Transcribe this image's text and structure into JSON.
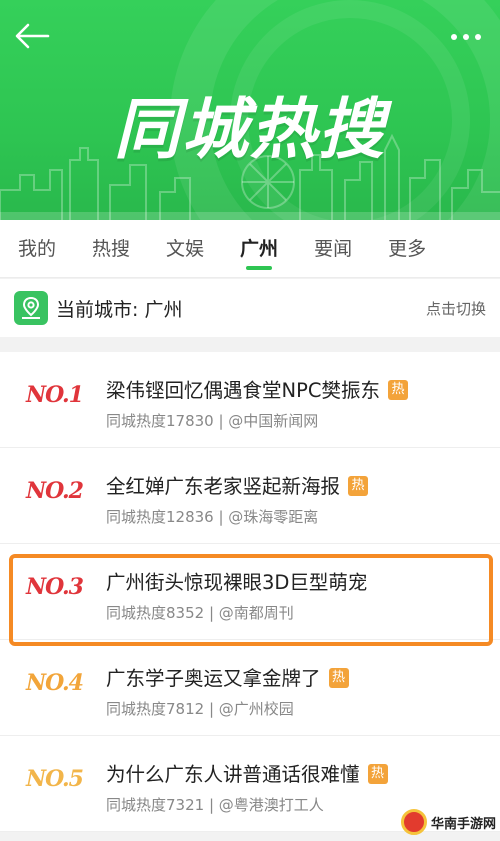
{
  "header": {
    "title": "同城热搜",
    "back_icon": "back-arrow-icon",
    "more_icon": "more-dots-icon",
    "colors": {
      "brand": "#2ec552"
    }
  },
  "tabs": [
    {
      "label": "我的",
      "active": false
    },
    {
      "label": "热搜",
      "active": false
    },
    {
      "label": "文娱",
      "active": false
    },
    {
      "label": "广州",
      "active": true
    },
    {
      "label": "要闻",
      "active": false
    },
    {
      "label": "更多",
      "active": false
    }
  ],
  "city": {
    "label": "当前城市: 广州",
    "switch_label": "点击切换",
    "icon": "location-pin-icon"
  },
  "list": [
    {
      "rank": "NO.1",
      "title": "梁伟铿回忆偶遇食堂NPC樊振东",
      "hot": "热",
      "meta": "同城热度17830 | @中国新闻网"
    },
    {
      "rank": "NO.2",
      "title": "全红婵广东老家竖起新海报",
      "hot": "热",
      "meta": "同城热度12836 | @珠海零距离"
    },
    {
      "rank": "NO.3",
      "title": "广州街头惊现裸眼3D巨型萌宠",
      "hot": "",
      "meta": "同城热度8352 | @南都周刊"
    },
    {
      "rank": "NO.4",
      "title": "广东学子奥运又拿金牌了",
      "hot": "热",
      "meta": "同城热度7812 | @广州校园"
    },
    {
      "rank": "NO.5",
      "title": "为什么广东人讲普通话很难懂",
      "hot": "热",
      "meta": "同城热度7321 | @粤港澳打工人"
    }
  ],
  "watermark": {
    "text": "华南手游网"
  }
}
